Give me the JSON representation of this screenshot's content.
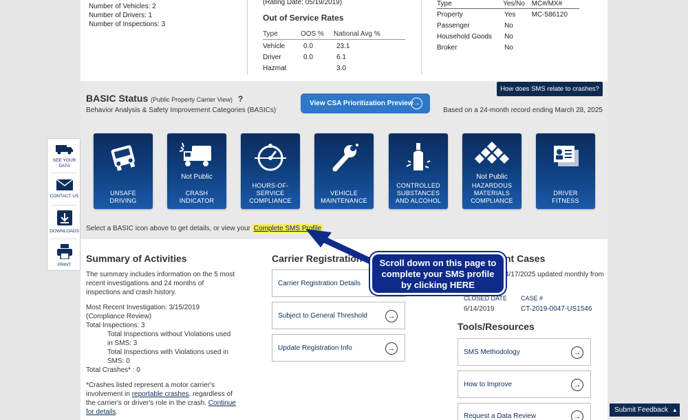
{
  "top": {
    "carrier_stats": [
      "Number of Vehicles: 2",
      "Number of Drivers: 1",
      "Number of Inspections: 3"
    ],
    "rating_date": "(Rating Date: 05/19/2019)",
    "oos_title": "Out of Service Rates",
    "oos_headers": [
      "Type",
      "OOS %",
      "National Avg %"
    ],
    "oos_rows": [
      [
        "Vehicle",
        "0.0",
        "23.1"
      ],
      [
        "Driver",
        "0.0",
        "6.1"
      ],
      [
        "Hazmat",
        "",
        "3.0"
      ]
    ],
    "ship_headers": [
      "Type",
      "Yes/No",
      "MC#/MX#"
    ],
    "ship_rows": [
      [
        "Property",
        "Yes",
        "MC-586120"
      ],
      [
        "Passenger",
        "No",
        ""
      ],
      [
        "Household Goods",
        "No",
        ""
      ],
      [
        "Broker",
        "No",
        ""
      ]
    ]
  },
  "basic": {
    "title": "BASIC Status",
    "title_small": "(Public Property Carrier View)",
    "help": "?",
    "subtitle": "Behavior Analysis & Safety Improvement Categories (BASICs)",
    "csa_button": "View CSA Prioritization Preview",
    "sms_relate": "How does SMS relate to crashes?",
    "rolling": "Based on a 24-month record ending March 28, 2025",
    "tiles": [
      {
        "icon": "truck-crash-icon",
        "np": "",
        "label1": "UNSAFE",
        "label2": "DRIVING",
        "label3": ""
      },
      {
        "icon": "truck-collision-icon",
        "np": "Not Public",
        "label1": "CRASH",
        "label2": "INDICATOR",
        "label3": ""
      },
      {
        "icon": "speedometer-icon",
        "np": "",
        "label1": "HOURS-OF-",
        "label2": "SERVICE",
        "label3": "COMPLIANCE"
      },
      {
        "icon": "wrench-icon",
        "np": "",
        "label1": "VEHICLE",
        "label2": "MAINTENANCE",
        "label3": ""
      },
      {
        "icon": "bottle-icon",
        "np": "",
        "label1": "CONTROLLED",
        "label2": "SUBSTANCES",
        "label3": "AND ALCOHOL"
      },
      {
        "icon": "hazmat-diamond-icon",
        "np": "Not Public",
        "label1": "HAZARDOUS",
        "label2": "MATERIALS",
        "label3": "COMPLIANCE"
      },
      {
        "icon": "id-card-icon",
        "np": "",
        "label1": "DRIVER",
        "label2": "FITNESS",
        "label3": ""
      }
    ],
    "select_text": "Select a BASIC icon above to get details, or view your",
    "select_link": "Complete SMS Profile"
  },
  "rail": [
    {
      "icon": "truck-icon",
      "label1": "SEE YOUR",
      "label2": "DATA"
    },
    {
      "icon": "envelope-icon",
      "label1": "CONTACT US",
      "label2": ""
    },
    {
      "icon": "download-icon",
      "label1": "DOWNLOADS",
      "label2": ""
    },
    {
      "icon": "printer-icon",
      "label1": "PRINT",
      "label2": ""
    }
  ],
  "summary": {
    "title": "Summary of Activities",
    "p1": "The summary includes information on the 5 most recent investigations and 24 months of inspections and crash history.",
    "recent": "Most Recent Investigation: 3/15/2019",
    "review": "(Compliance Review)",
    "total_insp": "Total Inspections: 3",
    "without": "Total Inspections without Violations used in SMS: 3",
    "with": "Total Inspections with Violations used in SMS: 0",
    "total_crashes": "Total Crashes* : 0",
    "note_a": "*Crashes listed represent a motor carrier's involvement in",
    "note_link": "reportable crashes",
    "note_b": ", regardless of the carrier's or driver's role in the crash.",
    "note_link2a": "Continue",
    "note_link2b": "for details",
    "note_end": "."
  },
  "registration": {
    "title": "Carrier Registration",
    "buttons": [
      "Carrier Registration Details",
      "Subject to General Threshold",
      "Update Registration Info"
    ]
  },
  "cases": {
    "title_tail": "nt Cases",
    "updated": "4/17/2025 updated monthly from",
    "headers": [
      "CLOSED DATE",
      "CASE #"
    ],
    "row": [
      "6/14/2019",
      "CT-2019-0047-US1546"
    ]
  },
  "tools": {
    "title": "Tools/Resources",
    "buttons": [
      "SMS Methodology",
      "How to Improve",
      "Request a Data Review"
    ]
  },
  "callout": {
    "text1": "Scroll down on this page to",
    "text2": "complete your SMS profile",
    "text3": "by clicking HERE"
  },
  "feedback": "Submit Feedback"
}
